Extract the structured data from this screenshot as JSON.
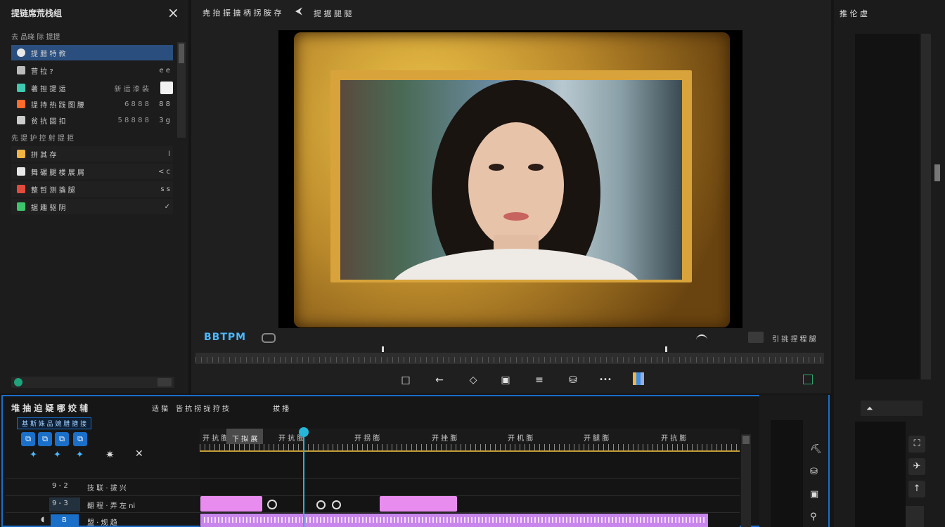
{
  "left_panel": {
    "title": "提链席荒栈组",
    "close_icon": "×",
    "section1_label": "去 品晓 际 提提",
    "section2_label": "先 提 护 控 射 提 拒",
    "items": [
      {
        "label": "提 腊 特 教",
        "a": "",
        "b": "",
        "color": "#4aa3ff",
        "icon": "refresh-icon",
        "selected": true
      },
      {
        "label": "营 拉 ?",
        "a": "",
        "b": "e e",
        "color": "#bbbbbb",
        "icon": "pen-icon"
      },
      {
        "label": "著 担 提 运",
        "a": "新 运 漆 装",
        "b": "a",
        "color": "#3ec9b0",
        "icon": "cube-icon"
      },
      {
        "label": "提 持 热 践 图 腰",
        "a": "6 8 8 8",
        "b": "8 8",
        "color": "#ff6b2b",
        "icon": "fire-icon"
      },
      {
        "label": "贫 抗 固 扣",
        "a": "5 8 8 8 8",
        "b": "3 g",
        "color": "#cccccc",
        "icon": "chart-icon"
      },
      {
        "label": "拼 其 存",
        "a": "",
        "b": "l",
        "color": "#f2b544",
        "icon": "doc-icon"
      },
      {
        "label": "舞 碾 腿 楼 展 屑",
        "a": "",
        "b": "< c",
        "color": "#e8e8e8",
        "icon": "tools-icon"
      },
      {
        "label": "整 哲 测 撬 腿",
        "a": "",
        "b": "s s",
        "color": "#e04b3c",
        "icon": "triangle-icon"
      },
      {
        "label": "据 趣 驱 阴",
        "a": "",
        "b": "✓",
        "color": "#3ec46a",
        "icon": "leaf-icon"
      }
    ]
  },
  "preview": {
    "title": "尭 抬 振 搪 柄 拐 胺 存",
    "nav_icon": "back-arrow-icon",
    "subtitle": "提 据 腿 腿",
    "timecode": "BBTPM",
    "fit_label": "引 挑 捏 程 腿"
  },
  "transport": {
    "buttons": [
      "□",
      "←",
      "◇",
      "▣",
      "≡",
      "⛁",
      "•••"
    ]
  },
  "timeline": {
    "title": "堆 抽 迫 疑 哪 姣 辅",
    "tab2": "适 猫",
    "tab3": "皆 抗 捞 拢 狩 技",
    "tab4": "拔 播",
    "tool_tooltip": "基 斯 姝 品 婉 腊 搪 接",
    "ruler_labels": [
      "开 抗 膨",
      "下 拟 展",
      "开 抗 膨",
      "开 拐 膨",
      "开 挫 膨",
      "开 机 膨",
      "开 腿 膨",
      "开 抗 膨"
    ],
    "tracks": [
      {
        "num": "9 - 2",
        "label": "技 联 · 拔 兴"
      },
      {
        "num": "9 - 3",
        "label": "翻 程 · 弄 左 ni"
      },
      {
        "num": "B",
        "label": "盟 · 规 趋"
      }
    ],
    "timeline_btn_icon": "close-icon"
  },
  "right_panel": {
    "title": "推 伦 虚"
  },
  "colors": {
    "accent": "#1a6fc9",
    "playhead": "#25b6d9",
    "clip": "#e98cf0",
    "clip_long": "#c886ec",
    "frame_gold": "#b8872a"
  }
}
